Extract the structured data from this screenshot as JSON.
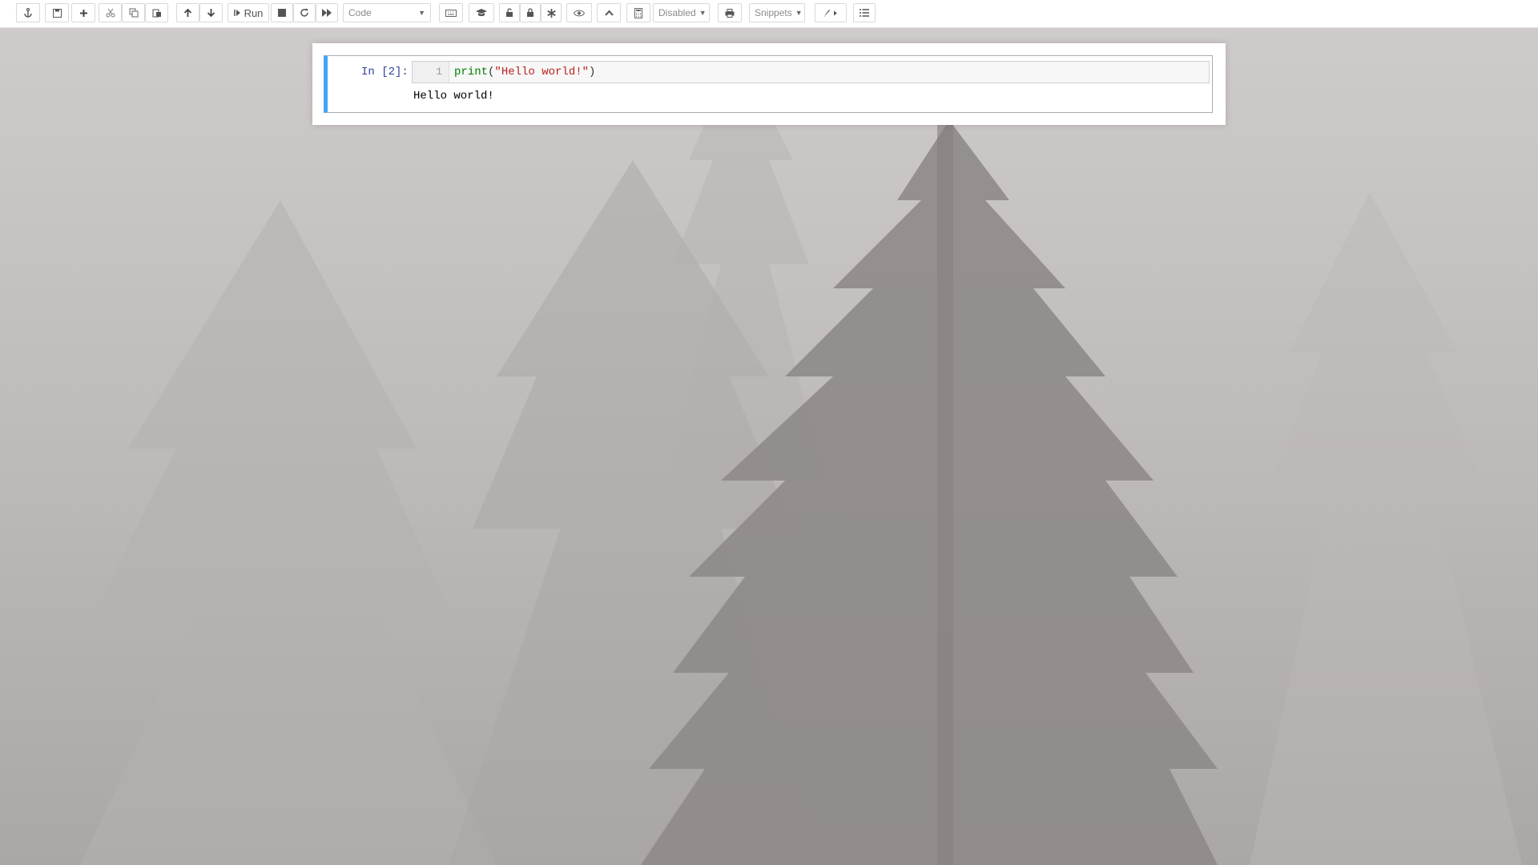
{
  "toolbar": {
    "run_label": "Run",
    "cell_type": "Code",
    "autosave": "Disabled",
    "snippets": "Snippets"
  },
  "cell": {
    "prompt": "In [2]:",
    "line_number": "1",
    "code_func": "print",
    "code_open": "(",
    "code_string": "\"Hello world!\"",
    "code_close": ")",
    "output": "Hello world!"
  },
  "icons": [
    "anchor-icon",
    "save-icon",
    "plus-icon",
    "cut-icon",
    "copy-icon",
    "paste-icon",
    "arrow-up-icon",
    "arrow-down-icon",
    "step-forward-icon",
    "stop-icon",
    "restart-icon",
    "fast-forward-icon",
    "keyboard-icon",
    "graduation-cap-icon",
    "unlock-icon",
    "lock-icon",
    "asterisk-icon",
    "eye-icon",
    "chevron-up-icon",
    "calculator-icon",
    "print-icon",
    "brush-icon",
    "list-icon"
  ]
}
